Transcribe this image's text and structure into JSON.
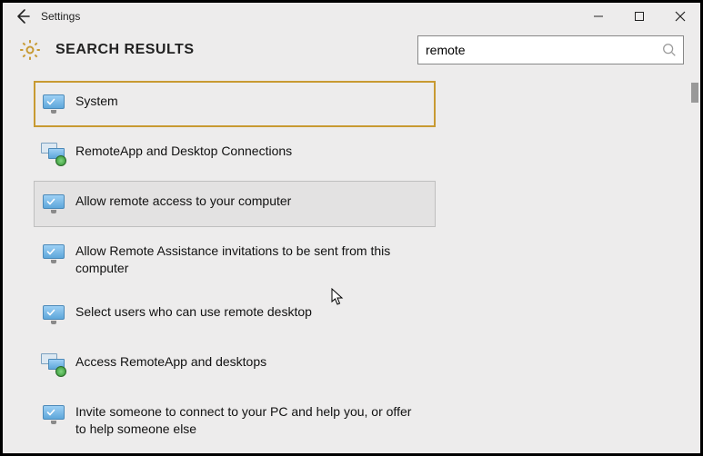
{
  "titlebar": {
    "title": "Settings"
  },
  "header": {
    "heading": "SEARCH RESULTS"
  },
  "search": {
    "value": "remote"
  },
  "results": [
    {
      "label": "System",
      "icon": "monitor-check",
      "state": "selected"
    },
    {
      "label": "RemoteApp and Desktop Connections",
      "icon": "monitor-pair-badge",
      "state": ""
    },
    {
      "label": "Allow remote access to your computer",
      "icon": "monitor-check",
      "state": "hover"
    },
    {
      "label": "Allow Remote Assistance invitations to be sent from this computer",
      "icon": "monitor-check",
      "state": ""
    },
    {
      "label": "Select users who can use remote desktop",
      "icon": "monitor-check",
      "state": ""
    },
    {
      "label": "Access RemoteApp and desktops",
      "icon": "monitor-pair-badge",
      "state": ""
    },
    {
      "label": "Invite someone to connect to your PC and help you, or offer to help someone else",
      "icon": "monitor-check",
      "state": ""
    }
  ]
}
